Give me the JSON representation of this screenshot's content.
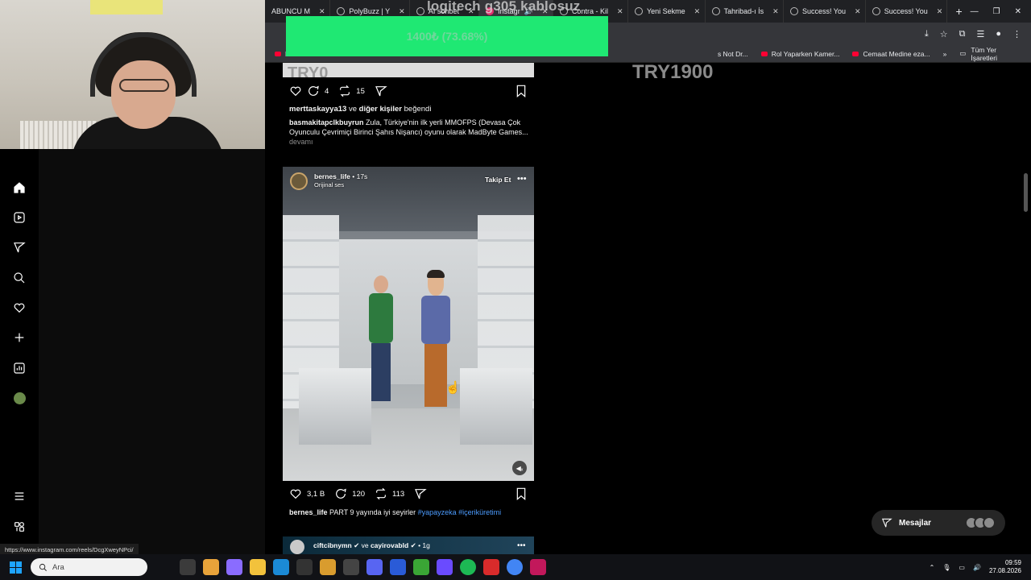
{
  "browser": {
    "tabs": [
      {
        "label": "ABUNCU M",
        "active": false
      },
      {
        "label": "PolyBuzz | Y",
        "active": false
      },
      {
        "label": "AI sohbet",
        "active": false
      },
      {
        "label": "Instagr",
        "active": true
      },
      {
        "label": "Contra - Kil",
        "active": false
      },
      {
        "label": "Yeni Sekme",
        "active": false
      },
      {
        "label": "Tahribad-ı İs",
        "active": false
      },
      {
        "label": "Success! You",
        "active": false
      },
      {
        "label": "Success! You",
        "active": false
      }
    ],
    "new_tab": "+",
    "bookmarks": [
      {
        "label": "Ro"
      },
      {
        "label": "s Not Dr..."
      },
      {
        "label": "Rol Yaparken Kamer..."
      },
      {
        "label": "Cemaat Medine eza..."
      }
    ],
    "bookmarks_more": "»",
    "all_bookmarks": "Tüm Yer İşaretleri"
  },
  "overlays": {
    "donation_text": "1400₺ (73.68%)",
    "logitech_text": "logitech g305 kablosuz",
    "goal_text": "TRY1900",
    "goal_partial": "TRY0"
  },
  "post1": {
    "likes_count": "",
    "comments": "4",
    "reposts": "15",
    "liked_by_user": "merttaskayya13",
    "liked_by_rest": "ve",
    "liked_by_others": "diğer kişiler",
    "liked_by_suffix": "beğendi",
    "caption_user": "basmakitapclkbuyrun",
    "caption_text": "Zula, Türkiye'nin ilk yerli MMOFPS (Devasa Çok Oyunculu Çevrimiçi Birinci Şahıs Nişancı) oyunu olarak MadByte Games...",
    "more": "devamı"
  },
  "post2": {
    "username": "bernes_life",
    "time": "• 17s",
    "audio": "Orijinal ses",
    "follow": "Takip Et",
    "likes": "3,1 B",
    "comments": "120",
    "reposts": "113",
    "caption_user": "bernes_life",
    "caption_text": "PART 9 yayında iyi seyirler",
    "tag1": "#yapayzeka",
    "tag2": "#içeriküretimi"
  },
  "post3": {
    "user1": "ciftcibnymn",
    "join": "ve",
    "user2": "cayirovabld",
    "time": "• 1g"
  },
  "messages": {
    "label": "Mesajlar"
  },
  "status_url": "https://www.instagram.com/reels/DcgXweyNPci/",
  "taskbar": {
    "search_placeholder": "Ara",
    "time": "09:59",
    "date": "27.08.2026"
  },
  "colors": {
    "donation_bar": "#1fe873",
    "link_blue": "#4c9cff",
    "ig_bg": "#000000"
  }
}
